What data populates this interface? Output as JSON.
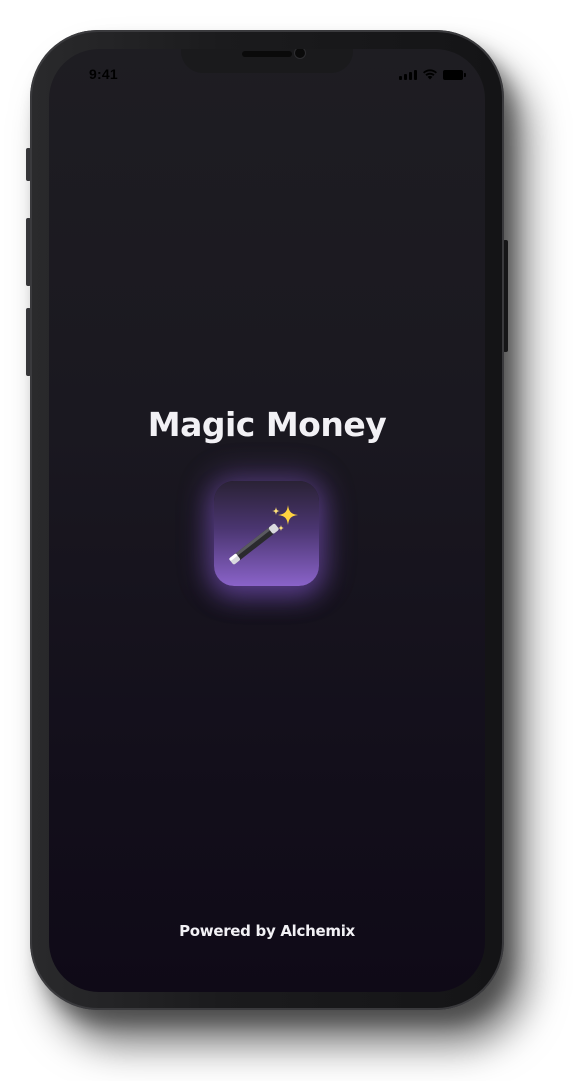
{
  "status_bar": {
    "time": "9:41",
    "icons": [
      "cellular-signal-icon",
      "wifi-icon",
      "battery-icon"
    ]
  },
  "splash": {
    "title": "Magic Money",
    "icon": "magic-wand-sparkles-icon",
    "footer": "Powered by Alchemix"
  },
  "colors": {
    "background_top": "#1e1d22",
    "background_bottom": "#0f0a17",
    "text": "#f2f1f5",
    "accent_purple": "#8a63c9"
  }
}
